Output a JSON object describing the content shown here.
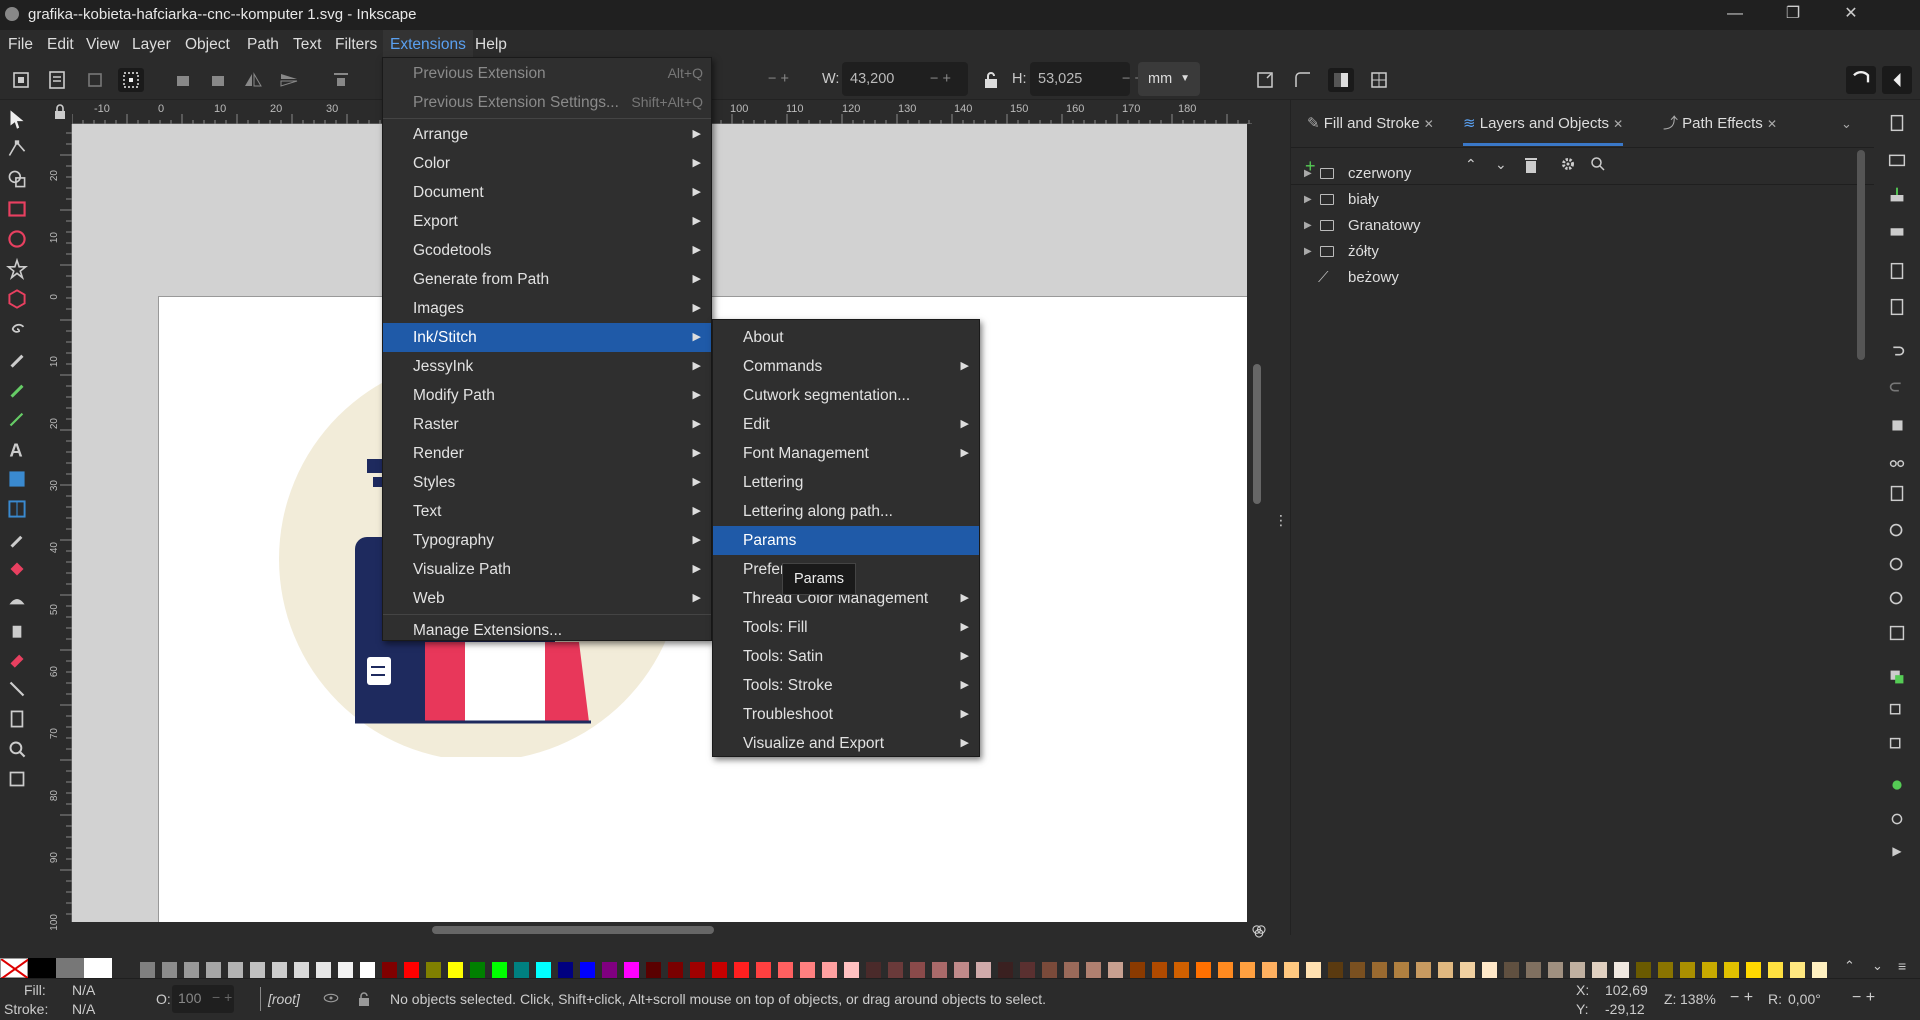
{
  "window": {
    "title": "grafika--kobieta-hafciarka--cnc--komputer 1.svg - Inkscape",
    "minimize": "—",
    "maximize": "❐",
    "close": "✕"
  },
  "menubar": [
    "File",
    "Edit",
    "View",
    "Layer",
    "Object",
    "Path",
    "Text",
    "Filters",
    "Extensions",
    "Help"
  ],
  "toolbar": {
    "w_label": "W:",
    "w_value": "43,200",
    "h_label": "H:",
    "h_value": "53,025",
    "unit": "mm"
  },
  "ruler_h": [
    "-10",
    "0",
    "10",
    "20",
    "30",
    "100",
    "110",
    "120",
    "130",
    "140",
    "150",
    "160",
    "170",
    "180"
  ],
  "ruler_v": [
    "30",
    "20",
    "10",
    "0",
    "10",
    "20",
    "30",
    "40",
    "50",
    "60",
    "70",
    "80",
    "90",
    "100"
  ],
  "extensions_menu": [
    {
      "label": "Previous Extension",
      "accel": "Alt+Q",
      "disabled": true
    },
    {
      "label": "Previous Extension Settings...",
      "accel": "Shift+Alt+Q",
      "disabled": true
    },
    {
      "label": "Arrange",
      "sub": true
    },
    {
      "label": "Color",
      "sub": true
    },
    {
      "label": "Document",
      "sub": true
    },
    {
      "label": "Export",
      "sub": true
    },
    {
      "label": "Gcodetools",
      "sub": true
    },
    {
      "label": "Generate from Path",
      "sub": true
    },
    {
      "label": "Images",
      "sub": true
    },
    {
      "label": "Ink/Stitch",
      "sub": true,
      "highlight": true
    },
    {
      "label": "JessyInk",
      "sub": true
    },
    {
      "label": "Modify Path",
      "sub": true
    },
    {
      "label": "Raster",
      "sub": true
    },
    {
      "label": "Render",
      "sub": true
    },
    {
      "label": "Styles",
      "sub": true
    },
    {
      "label": "Text",
      "sub": true
    },
    {
      "label": "Typography",
      "sub": true
    },
    {
      "label": "Visualize Path",
      "sub": true
    },
    {
      "label": "Web",
      "sub": true
    },
    {
      "label": "Manage Extensions...",
      "sub": false
    }
  ],
  "inkstitch_menu": [
    {
      "label": "About"
    },
    {
      "label": "Commands",
      "sub": true
    },
    {
      "label": "Cutwork segmentation..."
    },
    {
      "label": "Edit",
      "sub": true
    },
    {
      "label": "Font Management",
      "sub": true
    },
    {
      "label": "Lettering"
    },
    {
      "label": "Lettering along path..."
    },
    {
      "label": "Params",
      "highlight": true
    },
    {
      "label": "Preferences"
    },
    {
      "label": "Thread Color Management",
      "sub": true
    },
    {
      "label": "Tools: Fill",
      "sub": true
    },
    {
      "label": "Tools: Satin",
      "sub": true
    },
    {
      "label": "Tools: Stroke",
      "sub": true
    },
    {
      "label": "Troubleshoot",
      "sub": true
    },
    {
      "label": "Visualize and Export",
      "sub": true
    }
  ],
  "tooltip": "Params",
  "panel": {
    "tabs": [
      {
        "label": "Fill and Stroke"
      },
      {
        "label": "Layers and Objects",
        "selected": true
      },
      {
        "label": "Path Effects"
      }
    ],
    "close_glyph": "✕",
    "layers": [
      "czerwony",
      "biały",
      "Granatowy",
      "żółty",
      "beżowy"
    ]
  },
  "status": {
    "fill_label": "Fill:",
    "fill_value": "N/A",
    "stroke_label": "Stroke:",
    "stroke_value": "N/A",
    "opacity_label": "O:",
    "opacity_value": "100",
    "layer": "[root]",
    "message": "No objects selected. Click, Shift+click, Alt+scroll mouse on top of objects, or drag around objects to select.",
    "x_label": "X:",
    "x_value": "102,69",
    "y_label": "Y:",
    "y_value": "-29,12",
    "zoom_label": "Z:",
    "zoom_value": "138%",
    "rot_label": "R:",
    "rot_value": "0,00°"
  },
  "colors": {
    "accent": "#1f5aa8",
    "navy": "#1e2a5e",
    "red": "#e8375a",
    "beige": "#f2ecd9"
  },
  "palette": [
    "#808080",
    "#8c8c8c",
    "#999999",
    "#a6a6a6",
    "#b3b3b3",
    "#c0c0c0",
    "#cccccc",
    "#d9d9d9",
    "#e6e6e6",
    "#f2f2f2",
    "#ffffff",
    "#800000",
    "#ff0000",
    "#808000",
    "#ffff00",
    "#008000",
    "#00ff00",
    "#008080",
    "#00ffff",
    "#000080",
    "#0000ff",
    "#800080",
    "#ff00ff",
    "#5a0000",
    "#7a0000",
    "#a00000",
    "#c80000",
    "#ff2020",
    "#ff4040",
    "#ff6060",
    "#ff8080",
    "#ffa0a0",
    "#ffc0c0",
    "#4a2a2a",
    "#6a3a3a",
    "#8a4a4a",
    "#aa6a6a",
    "#c08a8a",
    "#d0aaaa",
    "#3a2020",
    "#5a3030",
    "#7a4a3a",
    "#9a6a5a",
    "#b08070",
    "#c8a090",
    "#8a3a00",
    "#b04a00",
    "#d06000",
    "#ff7000",
    "#ff8a20",
    "#ffa040",
    "#ffb060",
    "#ffc880",
    "#ffe0b0",
    "#5a3a10",
    "#7a5020",
    "#9a6a30",
    "#b08040",
    "#c89a60",
    "#e0b880",
    "#f0d0a0",
    "#ffe8c8",
    "#605040",
    "#807060",
    "#a09080",
    "#c0b0a0",
    "#e0d0c0",
    "#f0e8e0",
    "#6a5a00",
    "#8a7400",
    "#aa8f00",
    "#c8aa00",
    "#e0c000",
    "#ffd800",
    "#ffe040",
    "#ffe880",
    "#fff0c0"
  ]
}
